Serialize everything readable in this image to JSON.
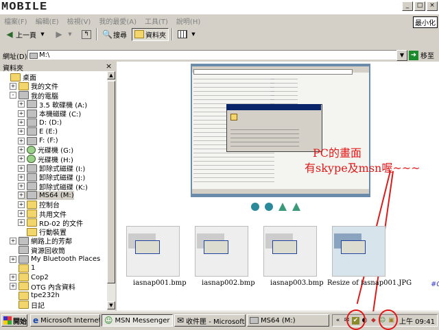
{
  "brand": {
    "text": "MOBILE"
  },
  "window": {
    "min_label": "最小化",
    "controls": [
      "_",
      "□",
      "×"
    ]
  },
  "menu": [
    "檔案(F)",
    "編輯(E)",
    "檢視(V)",
    "我的最愛(A)",
    "工具(T)",
    "說明(H)"
  ],
  "toolbar": {
    "back": "上一頁",
    "search": "搜尋",
    "folders": "資料夾"
  },
  "address": {
    "label": "網址(D)",
    "value": "M:\\",
    "go": "移至"
  },
  "folder_pane": {
    "title": "資料夾",
    "close": "×",
    "items": [
      {
        "label": "桌面",
        "indent": 0,
        "expander": "",
        "icon": "folder"
      },
      {
        "label": "我的文件",
        "indent": 1,
        "expander": "+",
        "icon": "folder"
      },
      {
        "label": "我的電腦",
        "indent": 1,
        "expander": "-",
        "icon": "drive"
      },
      {
        "label": "3.5 軟碟機 (A:)",
        "indent": 2,
        "expander": "+",
        "icon": "drive"
      },
      {
        "label": "本機磁碟 (C:)",
        "indent": 2,
        "expander": "+",
        "icon": "drive"
      },
      {
        "label": "D: (D:)",
        "indent": 2,
        "expander": "+",
        "icon": "drive"
      },
      {
        "label": "E (E:)",
        "indent": 2,
        "expander": "+",
        "icon": "drive"
      },
      {
        "label": "F: (F:)",
        "indent": 2,
        "expander": "+",
        "icon": "drive"
      },
      {
        "label": "光碟機 (G:)",
        "indent": 2,
        "expander": "+",
        "icon": "cd"
      },
      {
        "label": "光碟機 (H:)",
        "indent": 2,
        "expander": "+",
        "icon": "cd"
      },
      {
        "label": "卸除式磁碟 (I:)",
        "indent": 2,
        "expander": "+",
        "icon": "drive"
      },
      {
        "label": "卸除式磁碟 (J:)",
        "indent": 2,
        "expander": "+",
        "icon": "drive"
      },
      {
        "label": "卸除式磁碟 (K:)",
        "indent": 2,
        "expander": "+",
        "icon": "drive"
      },
      {
        "label": "MS64 (M:)",
        "indent": 2,
        "expander": "+",
        "icon": "drive",
        "selected": true
      },
      {
        "label": "控制台",
        "indent": 2,
        "expander": "+",
        "icon": "folder"
      },
      {
        "label": "共用文件",
        "indent": 2,
        "expander": "+",
        "icon": "folder"
      },
      {
        "label": "RD-02 的文件",
        "indent": 2,
        "expander": "+",
        "icon": "folder"
      },
      {
        "label": "行動裝置",
        "indent": 2,
        "expander": "",
        "icon": "folder"
      },
      {
        "label": "網路上的芳鄰",
        "indent": 1,
        "expander": "+",
        "icon": "drive"
      },
      {
        "label": "資源回收筒",
        "indent": 1,
        "expander": "",
        "icon": "drive"
      },
      {
        "label": "My Bluetooth Places",
        "indent": 1,
        "expander": "+",
        "icon": "drive"
      },
      {
        "label": "1",
        "indent": 1,
        "expander": "",
        "icon": "folder"
      },
      {
        "label": "Cop2",
        "indent": 1,
        "expander": "+",
        "icon": "folder"
      },
      {
        "label": "OTG 內含資料",
        "indent": 1,
        "expander": "+",
        "icon": "folder"
      },
      {
        "label": "tpe232h",
        "indent": 1,
        "expander": "",
        "icon": "folder"
      },
      {
        "label": "日記",
        "indent": 1,
        "expander": "",
        "icon": "folder"
      }
    ]
  },
  "annotation": {
    "line1": "PC的畫面",
    "line2": "有skype及msn喔~~~"
  },
  "thumbnails": [
    {
      "label": "iasnap001.bmp"
    },
    {
      "label": "iasnap002.bmp"
    },
    {
      "label": "iasnap003.bmp"
    },
    {
      "label": "Resize of iasnap001.JPG"
    }
  ],
  "taskbar": {
    "start": "開始",
    "tasks": [
      {
        "label": "Microsoft Internet ..."
      },
      {
        "label": "MSN Messenger (B..."
      },
      {
        "label": "收件匣 - Microsoft ..."
      },
      {
        "label": "MS64 (M:)"
      }
    ],
    "clock": "上午 09:41"
  },
  "desktop_corner": "#0",
  "colors": {
    "annotation": "#e01818",
    "titlebar_active": "#0a246a"
  }
}
